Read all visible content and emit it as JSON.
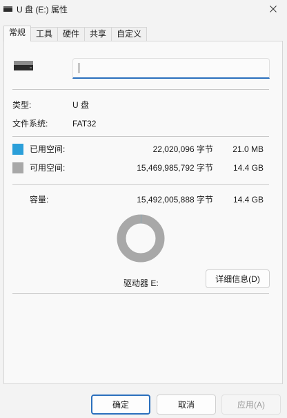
{
  "window": {
    "title": "U 盘 (E:) 属性"
  },
  "tabs": [
    {
      "label": "常规"
    },
    {
      "label": "工具"
    },
    {
      "label": "硬件"
    },
    {
      "label": "共享"
    },
    {
      "label": "自定义"
    }
  ],
  "general": {
    "name_value": "",
    "type_label": "类型:",
    "type_value": "U 盘",
    "fs_label": "文件系统:",
    "fs_value": "FAT32",
    "used": {
      "label": "已用空间:",
      "bytes": "22,020,096 字节",
      "size": "21.0 MB",
      "color": "#2b9fd9"
    },
    "free": {
      "label": "可用空间:",
      "bytes": "15,469,985,792 字节",
      "size": "14.4 GB",
      "color": "#a8a8a8"
    },
    "capacity": {
      "label": "容量:",
      "bytes": "15,492,005,888 字节",
      "size": "14.4 GB"
    },
    "drive_label": "驱动器 E:",
    "details_button": "详细信息(D)"
  },
  "footer": {
    "ok": "确定",
    "cancel": "取消",
    "apply": "应用(A)"
  },
  "colors": {
    "accent": "#2a6fbd",
    "used": "#2b9fd9",
    "free": "#a8a8a8"
  }
}
